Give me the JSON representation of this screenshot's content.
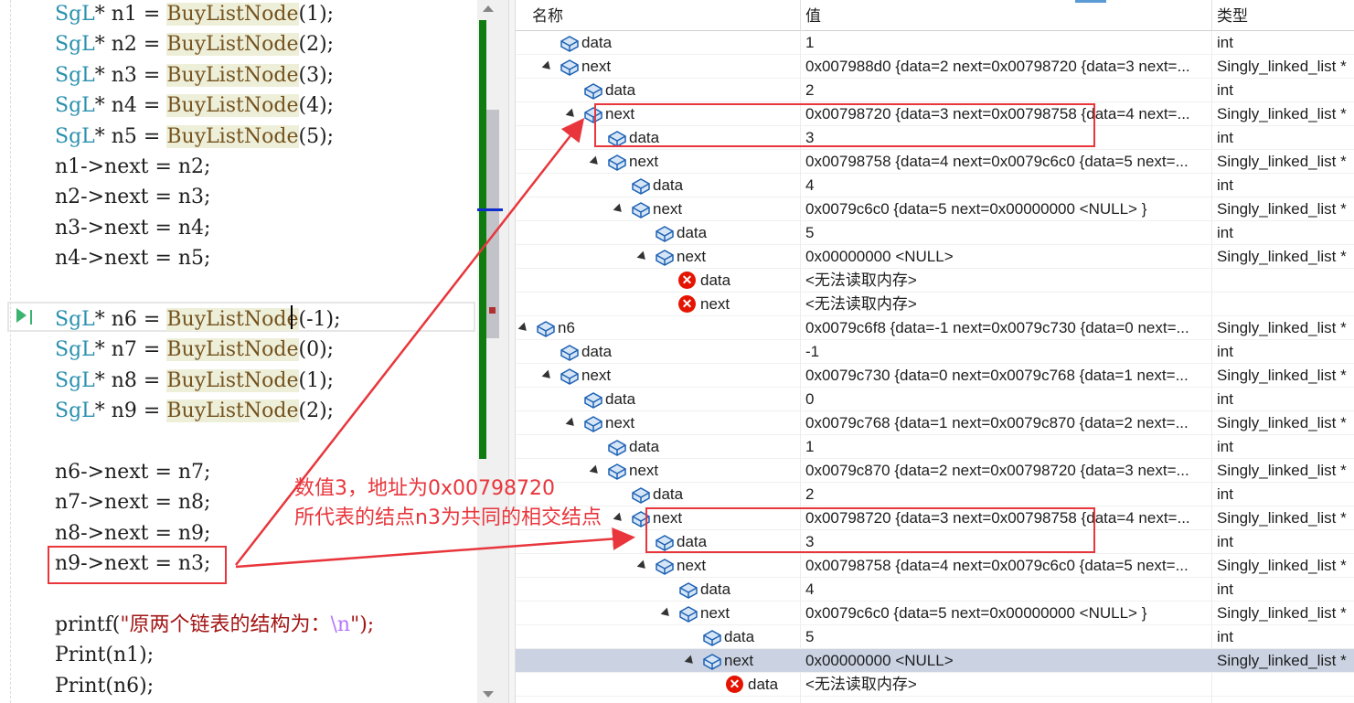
{
  "editor": {
    "lines": [
      {
        "type": "SgL",
        "op": "* ",
        "var": "n1",
        "eq": " = ",
        "fn": "BuyListNode",
        "args": "(1);"
      },
      {
        "type": "SgL",
        "op": "* ",
        "var": "n2",
        "eq": " = ",
        "fn": "BuyListNode",
        "args": "(2);"
      },
      {
        "type": "SgL",
        "op": "* ",
        "var": "n3",
        "eq": " = ",
        "fn": "BuyListNode",
        "args": "(3);"
      },
      {
        "type": "SgL",
        "op": "* ",
        "var": "n4",
        "eq": " = ",
        "fn": "BuyListNode",
        "args": "(4);"
      },
      {
        "type": "SgL",
        "op": "* ",
        "var": "n5",
        "eq": " = ",
        "fn": "BuyListNode",
        "args": "(5);"
      },
      {
        "plain": "n1->next = n2;"
      },
      {
        "plain": "n2->next = n3;"
      },
      {
        "plain": "n3->next = n4;"
      },
      {
        "plain": "n4->next = n5;"
      },
      {
        "plain": ""
      },
      {
        "type": "SgL",
        "op": "* ",
        "var": "n6",
        "eq": " = ",
        "fn": "BuyListNode",
        "args": "(-1);"
      },
      {
        "type": "SgL",
        "op": "* ",
        "var": "n7",
        "eq": " = ",
        "fn": "BuyListNode",
        "args": "(0);"
      },
      {
        "type": "SgL",
        "op": "* ",
        "var": "n8",
        "eq": " = ",
        "fn": "BuyListNode",
        "args": "(1);"
      },
      {
        "type": "SgL",
        "op": "* ",
        "var": "n9",
        "eq": " = ",
        "fn": "BuyListNode",
        "args": "(2);"
      },
      {
        "plain": ""
      },
      {
        "plain": "n6->next = n7;"
      },
      {
        "plain": "n7->next = n8;"
      },
      {
        "plain": "n8->next = n9;"
      },
      {
        "plain": "n9->next = n3;"
      },
      {
        "plain": ""
      },
      {
        "printf": true,
        "pre": "printf(",
        "str": "\"原两个链表的结构为：",
        "esc": "\\n",
        "post": "\");"
      },
      {
        "plain": "Print(n1);"
      },
      {
        "plain": "Print(n6);"
      }
    ]
  },
  "watch": {
    "columns": {
      "name": "名称",
      "value": "值",
      "type": "类型"
    },
    "rows": [
      {
        "indent": 2,
        "expander": false,
        "icon": "object-icon",
        "name": "data",
        "value": "1",
        "type": "int"
      },
      {
        "indent": 2,
        "expander": true,
        "icon": "object-icon",
        "name": "next",
        "value": "0x007988d0 {data=2 next=0x00798720 {data=3 next=...",
        "type": "Singly_linked_list *"
      },
      {
        "indent": 3,
        "expander": false,
        "icon": "object-icon",
        "name": "data",
        "value": "2",
        "type": "int"
      },
      {
        "indent": 3,
        "expander": true,
        "icon": "object-icon",
        "name": "next",
        "value": "0x00798720 {data=3 next=0x00798758 {data=4 next=...",
        "type": "Singly_linked_list *"
      },
      {
        "indent": 4,
        "expander": false,
        "icon": "object-icon",
        "name": "data",
        "value": "3",
        "type": "int"
      },
      {
        "indent": 4,
        "expander": true,
        "icon": "object-icon",
        "name": "next",
        "value": "0x00798758 {data=4 next=0x0079c6c0 {data=5 next=...",
        "type": "Singly_linked_list *"
      },
      {
        "indent": 5,
        "expander": false,
        "icon": "object-icon",
        "name": "data",
        "value": "4",
        "type": "int"
      },
      {
        "indent": 5,
        "expander": true,
        "icon": "object-icon",
        "name": "next",
        "value": "0x0079c6c0 {data=5 next=0x00000000 <NULL> }",
        "type": "Singly_linked_list *"
      },
      {
        "indent": 6,
        "expander": false,
        "icon": "object-icon",
        "name": "data",
        "value": "5",
        "type": "int"
      },
      {
        "indent": 6,
        "expander": true,
        "icon": "object-icon",
        "name": "next",
        "value": "0x00000000 <NULL>",
        "type": "Singly_linked_list *"
      },
      {
        "indent": 7,
        "expander": false,
        "icon": "error-icon",
        "name": "data",
        "value": "<无法读取内存>",
        "type": ""
      },
      {
        "indent": 7,
        "expander": false,
        "icon": "error-icon",
        "name": "next",
        "value": "<无法读取内存>",
        "type": ""
      },
      {
        "indent": 1,
        "expander": true,
        "icon": "object-icon",
        "name": "n6",
        "value": "0x0079c6f8 {data=-1 next=0x0079c730 {data=0 next=...",
        "type": "Singly_linked_list *"
      },
      {
        "indent": 2,
        "expander": false,
        "icon": "object-icon",
        "name": "data",
        "value": "-1",
        "type": "int"
      },
      {
        "indent": 2,
        "expander": true,
        "icon": "object-icon",
        "name": "next",
        "value": "0x0079c730 {data=0 next=0x0079c768 {data=1 next=...",
        "type": "Singly_linked_list *"
      },
      {
        "indent": 3,
        "expander": false,
        "icon": "object-icon",
        "name": "data",
        "value": "0",
        "type": "int"
      },
      {
        "indent": 3,
        "expander": true,
        "icon": "object-icon",
        "name": "next",
        "value": "0x0079c768 {data=1 next=0x0079c870 {data=2 next=...",
        "type": "Singly_linked_list *"
      },
      {
        "indent": 4,
        "expander": false,
        "icon": "object-icon",
        "name": "data",
        "value": "1",
        "type": "int"
      },
      {
        "indent": 4,
        "expander": true,
        "icon": "object-icon",
        "name": "next",
        "value": "0x0079c870 {data=2 next=0x00798720 {data=3 next=...",
        "type": "Singly_linked_list *"
      },
      {
        "indent": 5,
        "expander": false,
        "icon": "object-icon",
        "name": "data",
        "value": "2",
        "type": "int"
      },
      {
        "indent": 5,
        "expander": true,
        "icon": "object-icon",
        "name": "next",
        "value": "0x00798720 {data=3 next=0x00798758 {data=4 next=...",
        "type": "Singly_linked_list *"
      },
      {
        "indent": 6,
        "expander": false,
        "icon": "object-icon",
        "name": "data",
        "value": "3",
        "type": "int"
      },
      {
        "indent": 6,
        "expander": true,
        "icon": "object-icon",
        "name": "next",
        "value": "0x00798758 {data=4 next=0x0079c6c0 {data=5 next=...",
        "type": "Singly_linked_list *"
      },
      {
        "indent": 7,
        "expander": false,
        "icon": "object-icon",
        "name": "data",
        "value": "4",
        "type": "int"
      },
      {
        "indent": 7,
        "expander": true,
        "icon": "object-icon",
        "name": "next",
        "value": "0x0079c6c0 {data=5 next=0x00000000 <NULL> }",
        "type": "Singly_linked_list *"
      },
      {
        "indent": 8,
        "expander": false,
        "icon": "object-icon",
        "name": "data",
        "value": "5",
        "type": "int"
      },
      {
        "indent": 8,
        "expander": true,
        "icon": "object-icon",
        "name": "next",
        "value": "0x00000000 <NULL>",
        "type": "Singly_linked_list *",
        "selected": true
      },
      {
        "indent": 9,
        "expander": false,
        "icon": "error-icon",
        "name": "data",
        "value": "<无法读取内存>",
        "type": ""
      }
    ]
  },
  "annotation": {
    "line1": "数值3，地址为0x00798720",
    "line2": "所代表的结点n3为共同的相交结点",
    "color": "#e8363c"
  }
}
